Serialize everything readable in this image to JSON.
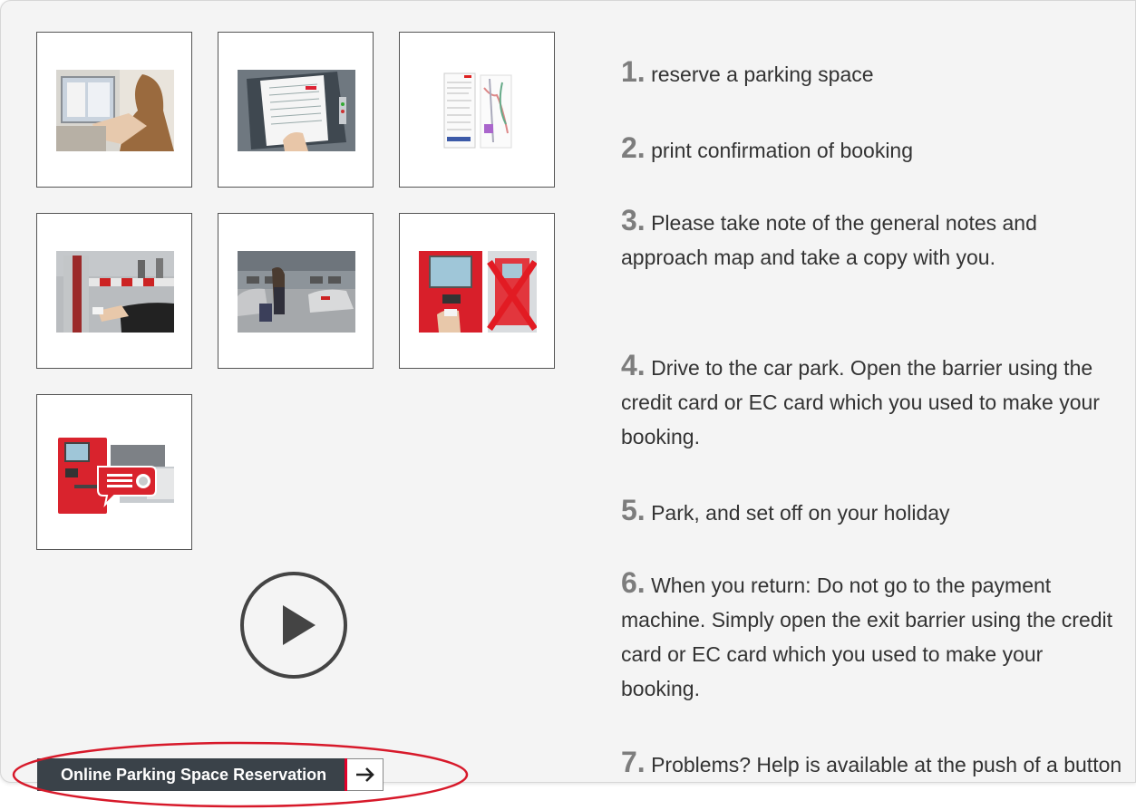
{
  "thumbnails": [
    {
      "icon": "computer-booking-photo"
    },
    {
      "icon": "printed-confirmation-photo"
    },
    {
      "icon": "approach-map-document"
    },
    {
      "icon": "barrier-card-photo"
    },
    {
      "icon": "car-park-traveller-photo"
    },
    {
      "icon": "payment-machine-crossed-photo"
    },
    {
      "icon": "help-button-terminal-photo"
    }
  ],
  "play_button": {
    "icon": "play-icon"
  },
  "steps": [
    {
      "num": "1.",
      "text": "reserve a parking space"
    },
    {
      "num": "2.",
      "text": "print confirmation of booking"
    },
    {
      "num": "3.",
      "text": "Please take note of the general notes and approach map and take a copy with you."
    },
    {
      "num": "4.",
      "text": "Drive to the car park. Open the barrier using the credit card or EC card which you used to make your booking."
    },
    {
      "num": "5.",
      "text": "Park, and set off on your holiday"
    },
    {
      "num": "6.",
      "text": "When you return: Do not go to the payment machine. Simply open the exit barrier using the credit card or EC card which you used to make your booking."
    },
    {
      "num": "7.",
      "text": "Problems? Help is available at the push of a button"
    }
  ],
  "reserve_button": {
    "label": "Online Parking Space Reservation",
    "icon": "arrow-right-icon"
  },
  "colors": {
    "accent": "#e3002b",
    "button_bg": "#3a4249",
    "annotation": "#d7192a"
  }
}
